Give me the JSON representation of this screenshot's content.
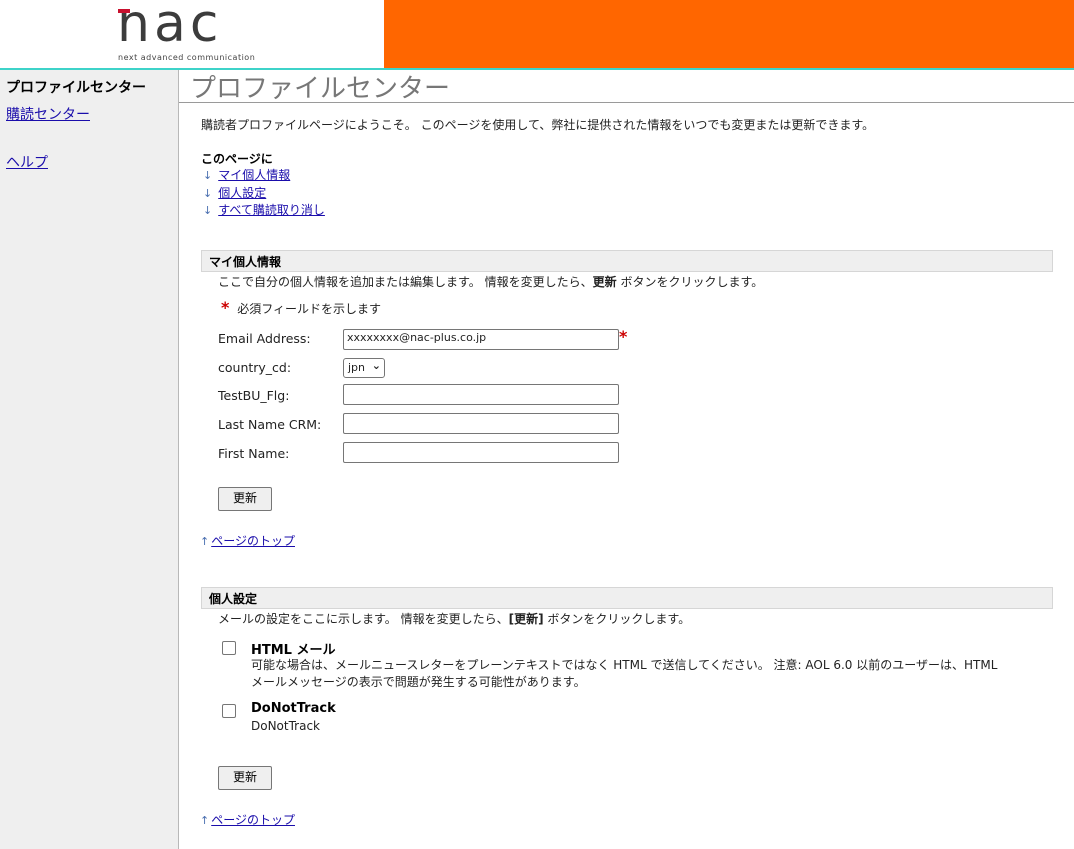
{
  "brand": {
    "logo_text": "nac",
    "logo_tagline": "next advanced communication",
    "accent_color": "#ff6600",
    "rule_color": "#3dd3c9"
  },
  "sidebar": {
    "title": "プロファイルセンター",
    "links": [
      {
        "label": "購読センター"
      },
      {
        "label": "ヘルプ"
      }
    ]
  },
  "page": {
    "title": "プロファイルセンター",
    "welcome": "購読者プロファイルページにようこそ。 このページを使用して、弊社に提供された情報をいつでも変更または更新できます。",
    "toc_title": "このページに",
    "toc": [
      {
        "label": "マイ個人情報"
      },
      {
        "label": "個人設定"
      },
      {
        "label": "すべて購読取り消し"
      }
    ],
    "arrow_down": "↓",
    "arrow_up": "↑",
    "back_to_top": "ページのトップ"
  },
  "personal": {
    "heading": "マイ個人情報",
    "instruction_pre": "ここで自分の個人情報を追加または編集します。 情報を変更したら、",
    "instruction_bold": "更新",
    "instruction_post": " ボタンをクリックします。",
    "required_mark": "*",
    "required_note": "必須フィールドを示します",
    "fields": [
      {
        "label": "Email Address:",
        "value": "xxxxxxxx@nac-plus.co.jp",
        "required": true
      },
      {
        "label": "country_cd:",
        "value": "jpn"
      },
      {
        "label": "TestBU_Flg:",
        "value": ""
      },
      {
        "label": "Last Name CRM:",
        "value": ""
      },
      {
        "label": "First Name:",
        "value": ""
      }
    ],
    "update_label": "更新"
  },
  "preferences": {
    "heading": "個人設定",
    "instruction_pre": "メールの設定をここに示します。 情報を変更したら、",
    "instruction_bold": "[更新]",
    "instruction_post": " ボタンをクリックします。",
    "options": [
      {
        "title": "HTML メール",
        "desc_line1": "可能な場合は、メールニュースレターをプレーンテキストではなく HTML で送信してください。 注意: AOL 6.0 以前のユーザーは、HTML",
        "desc_line2": "メールメッセージの表示で問題が発生する可能性があります。",
        "checked": false
      },
      {
        "title": "DoNotTrack",
        "desc_line1": "DoNotTrack",
        "checked": false
      }
    ],
    "update_label": "更新"
  }
}
